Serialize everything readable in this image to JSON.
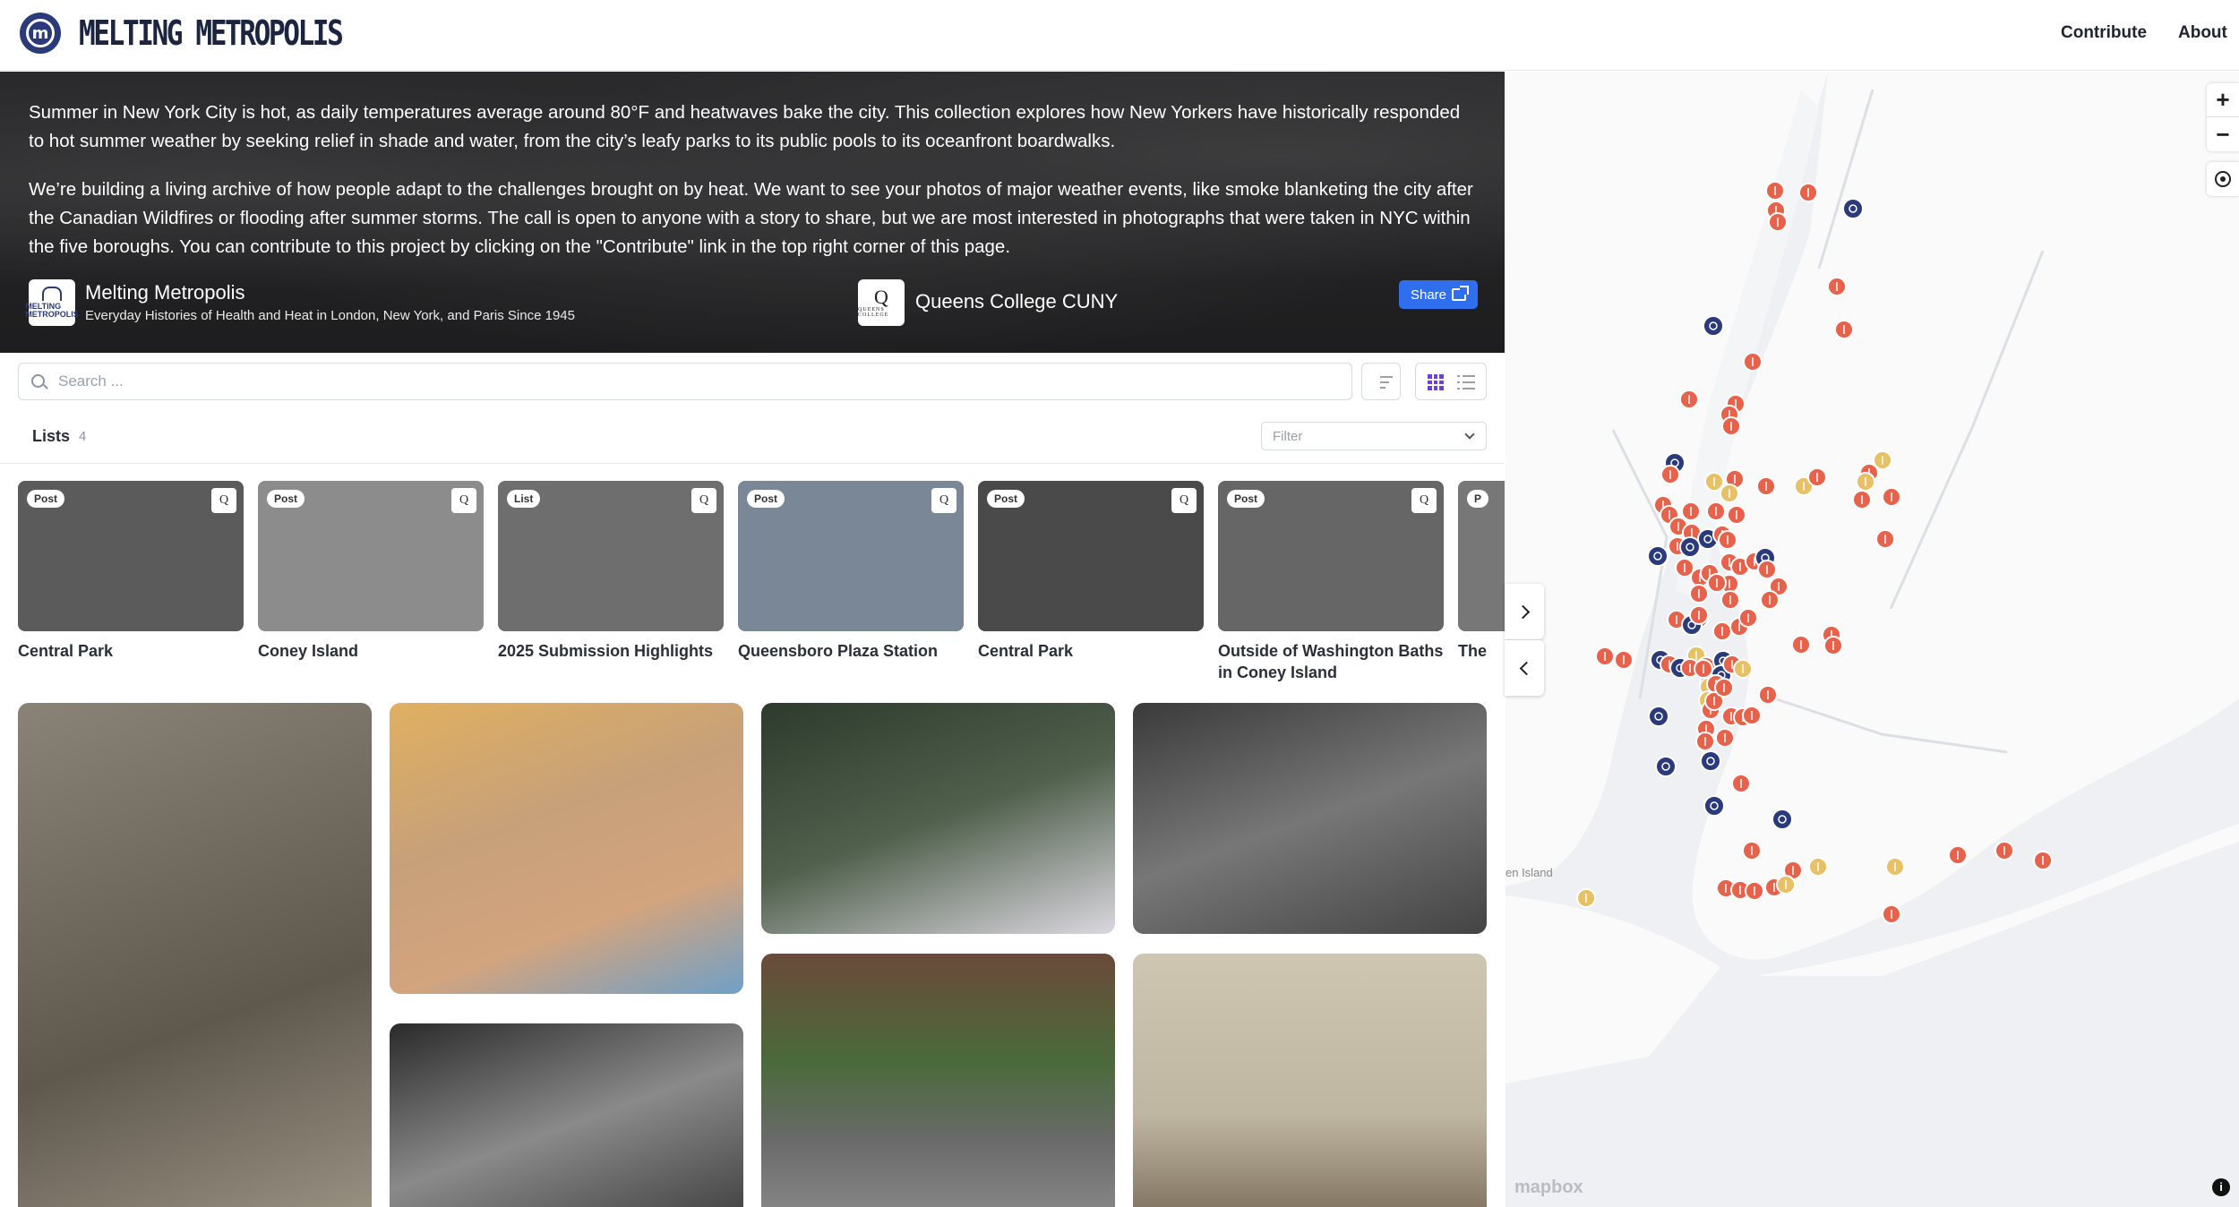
{
  "brand": {
    "name": "MELTING METROPOLIS"
  },
  "nav": {
    "contribute": "Contribute",
    "about": "About"
  },
  "hero": {
    "p1": "Summer in New York City is hot, as daily temperatures average around 80°F and heatwaves bake the city. This collection explores how New Yorkers have historically responded to hot summer weather by seeking relief in shade and water, from the city’s leafy parks to its public pools to its oceanfront boardwalks.",
    "p2": "We’re building a living archive of how people adapt to the challenges brought on by heat. We want to see your photos of major weather events, like smoke blanketing the city after the Canadian Wildfires or flooding after summer storms. The call is open to anyone with a story to share, but we are most interested in photographs that were taken in NYC within the five boroughs. You can contribute to this project by clicking on the \"Contribute\" link in the top right corner of this page.",
    "project_name": "Melting Metropolis",
    "project_subtitle": "Everyday Histories of Health and Heat in London, New York, and Paris Since 1945",
    "project_badge_text": "MELTING METROPOLIS",
    "partner_name": "Queens College CUNY",
    "partner_badge_text": "QUEENS COLLEGE",
    "share_label": "Share"
  },
  "search": {
    "placeholder": "Search ..."
  },
  "lists": {
    "label": "Lists",
    "count": "4",
    "filter_placeholder": "Filter"
  },
  "cards": [
    {
      "tag": "Post",
      "title": "Central Park",
      "bg": "#5b5b5b"
    },
    {
      "tag": "Post",
      "title": "Coney Island",
      "bg": "#8c8c8c"
    },
    {
      "tag": "List",
      "title": "2025 Submission Highlights",
      "bg": "#6e6e6e"
    },
    {
      "tag": "Post",
      "title": "Queensboro Plaza Station",
      "bg": "#7a8796"
    },
    {
      "tag": "Post",
      "title": "Central Park",
      "bg": "#4a4a4a"
    },
    {
      "tag": "Post",
      "title": "Outside of Washington Baths in Coney Island",
      "bg": "#666666"
    },
    {
      "tag": "P",
      "title": "The",
      "bg": "#777777"
    }
  ],
  "photos": [
    {
      "bg": "linear-gradient(160deg,#8a8378,#5f584d 60%,#9a9283)"
    },
    {
      "bg": "linear-gradient(160deg,#e0b060,#c7a07a 40%,#d3a47e 70%,#6fa0c8)"
    },
    {
      "bg": "linear-gradient(160deg,#2d3a2d,#50604c 50%,#dbd8e0)"
    },
    {
      "bg": "linear-gradient(160deg,#3a3a3a,#777 50%,#444)"
    },
    {
      "bg": "linear-gradient(160deg,#2a2a2a,#8a8a8a 50%,#3d3d3d)"
    },
    {
      "bg": "linear-gradient(180deg,#6a4a3a,#4a6a3a 40%,#6a6a6a 70%,#8a8a8a)"
    },
    {
      "bg": "linear-gradient(180deg,#cfc6b2,#bfb6a2 60%,#7c6f5b)"
    }
  ],
  "map": {
    "attribution": "mapbox",
    "place_label": "en Island",
    "zoom_in": "+",
    "zoom_out": "−",
    "info": "i",
    "colors": {
      "water": "#eef0f3",
      "land": "#fafafa",
      "post": "#e8614a",
      "list": "#2b3a7a",
      "other": "#e8c065"
    }
  }
}
